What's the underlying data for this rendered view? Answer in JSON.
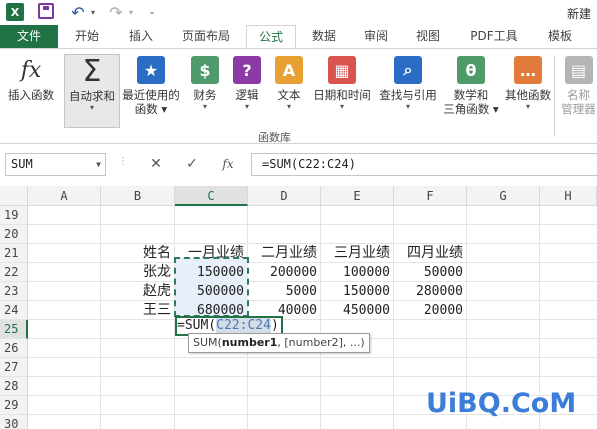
{
  "app": {
    "logo_text": "X",
    "window_title": "新建"
  },
  "quick_access": {
    "undo": "↶",
    "redo": "↷",
    "dropdown": "▾",
    "customize": "⌄"
  },
  "tabs": [
    {
      "label": "文件"
    },
    {
      "label": "开始"
    },
    {
      "label": "插入"
    },
    {
      "label": "页面布局"
    },
    {
      "label": "公式"
    },
    {
      "label": "数据"
    },
    {
      "label": "审阅"
    },
    {
      "label": "视图"
    },
    {
      "label": "PDF工具"
    },
    {
      "label": "模板"
    }
  ],
  "ribbon": {
    "group_label": "函数库",
    "buttons": [
      {
        "line1": "插入函数",
        "line2": "",
        "icon": "fx",
        "color": "#ffffff"
      },
      {
        "line1": "自动求和",
        "line2": "▾",
        "icon": "Σ",
        "color": "#ffffff"
      },
      {
        "line1": "最近使用的",
        "line2": "函数 ▾",
        "icon": "★",
        "color": "#2b6cc4"
      },
      {
        "line1": "财务",
        "line2": "▾",
        "icon": "$",
        "color": "#4f9a6b"
      },
      {
        "line1": "逻辑",
        "line2": "▾",
        "icon": "?",
        "color": "#8b3aa6"
      },
      {
        "line1": "文本",
        "line2": "▾",
        "icon": "A",
        "color": "#e8a033"
      },
      {
        "line1": "日期和时间",
        "line2": "▾",
        "icon": "▦",
        "color": "#d9534f"
      },
      {
        "line1": "查找与引用",
        "line2": "▾",
        "icon": "⌕",
        "color": "#2b6cc4"
      },
      {
        "line1": "数学和",
        "line2": "三角函数 ▾",
        "icon": "θ",
        "color": "#4f9a6b"
      },
      {
        "line1": "其他函数",
        "line2": "▾",
        "icon": "…",
        "color": "#e07b39"
      },
      {
        "line1": "名称",
        "line2": "管理器",
        "icon": "▤",
        "color": "#b5b5b5"
      }
    ]
  },
  "formula_bar": {
    "name_box": "SUM",
    "cancel": "✕",
    "enter": "✓",
    "fx": "fx",
    "formula": "=SUM(C22:C24)"
  },
  "grid": {
    "columns": [
      "A",
      "B",
      "C",
      "D",
      "E",
      "F",
      "G",
      "H"
    ],
    "rows": [
      "19",
      "20",
      "21",
      "22",
      "23",
      "24",
      "25",
      "26",
      "27",
      "28",
      "29",
      "30"
    ],
    "header_row": [
      "姓名",
      "一月业绩",
      "二月业绩",
      "三月业绩",
      "四月业绩"
    ],
    "data_rows": [
      [
        "张龙",
        "150000",
        "200000",
        "100000",
        "50000"
      ],
      [
        "赵虎",
        "500000",
        "5000",
        "150000",
        "280000"
      ],
      [
        "王三",
        "680000",
        "40000",
        "450000",
        "20000"
      ]
    ],
    "editing": {
      "prefix": "=SUM(",
      "ref": "C22:C24",
      "suffix": ")"
    },
    "tooltip": {
      "fn": "SUM(",
      "arg1": "number1",
      "rest": ", [number2], ...)"
    }
  },
  "watermark": "UiBQ.CoM"
}
